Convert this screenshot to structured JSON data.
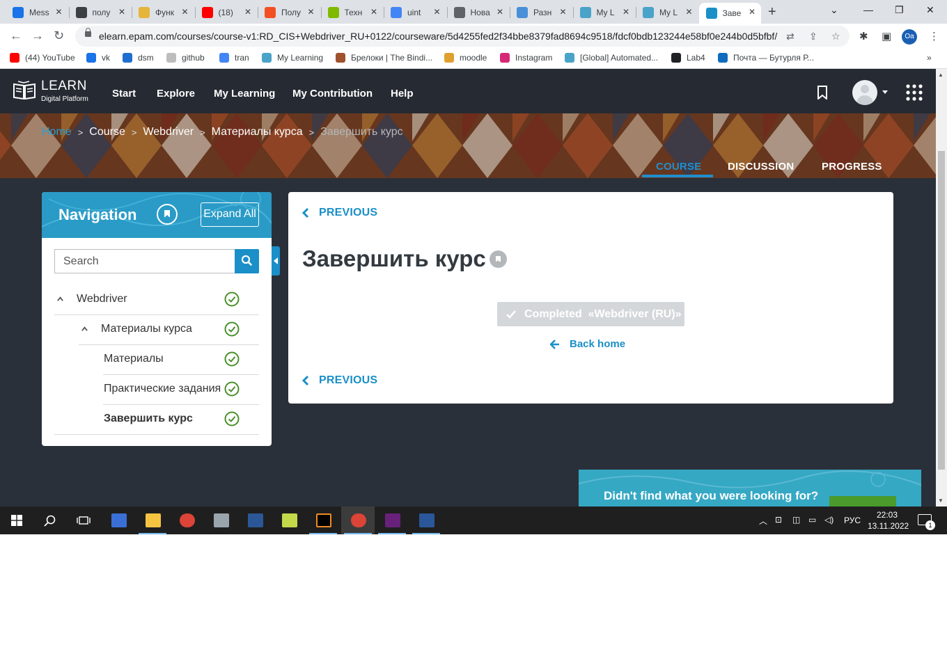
{
  "browser": {
    "tabs": [
      {
        "title": "Mess",
        "color": "#1a73e8"
      },
      {
        "title": "полу",
        "color": "#3c4043"
      },
      {
        "title": "Функ",
        "color": "#e5b53c"
      },
      {
        "title": "(18) ",
        "color": "#ff0000"
      },
      {
        "title": "Полу",
        "color": "#f25022"
      },
      {
        "title": "Техн",
        "color": "#7fba00"
      },
      {
        "title": "uint ",
        "color": "#4285f4"
      },
      {
        "title": "Нова",
        "color": "#5f6368"
      },
      {
        "title": "Разн",
        "color": "#4a90d9"
      },
      {
        "title": "My L",
        "color": "#4aa3c8"
      },
      {
        "title": "My L",
        "color": "#4aa3c8"
      },
      {
        "title": "Заве",
        "color": "#1a8fc8"
      }
    ],
    "url": "elearn.epam.com/courses/course-v1:RD_CIS+Webdriver_RU+0122/courseware/5d4255fed2f34bbe8379fad8694c9518/fdcf0bdb123244e58bf0e244b0d5bfbf/",
    "profile_initials": "Oa",
    "bookmarks": [
      {
        "label": "(44) YouTube",
        "color": "#ff0000"
      },
      {
        "label": "vk",
        "color": "#1a73e8"
      },
      {
        "label": "dsm",
        "color": "#1f6fd1"
      },
      {
        "label": "github",
        "color": "#bdbdbd"
      },
      {
        "label": "tran",
        "color": "#4285f4"
      },
      {
        "label": "My Learning",
        "color": "#4aa3c8"
      },
      {
        "label": "Брелоки | The Bindi...",
        "color": "#a0522d"
      },
      {
        "label": "moodle",
        "color": "#e0a030"
      },
      {
        "label": "Instagram",
        "color": "#d62976"
      },
      {
        "label": "[Global] Automated...",
        "color": "#4aa3c8"
      },
      {
        "label": "Lab4",
        "color": "#202124"
      },
      {
        "label": "Почта — Бутурля Р...",
        "color": "#0f6cbd"
      }
    ],
    "bookmarks_more": "»"
  },
  "header": {
    "logo_title": "LEARN",
    "logo_subtitle": "Digital Platform",
    "nav": [
      "Start",
      "Explore",
      "My Learning",
      "My Contribution",
      "Help"
    ]
  },
  "breadcrumb": {
    "items": [
      "Home",
      "Course",
      "Webdriver",
      "Материалы курса",
      "Завершить курс"
    ],
    "separator": ">"
  },
  "course_tabs": {
    "items": [
      "COURSE",
      "DISCUSSION",
      "PROGRESS"
    ],
    "active": "COURSE"
  },
  "navigation": {
    "title": "Navigation",
    "expand_label": "Expand All",
    "search_placeholder": "Search",
    "items": [
      {
        "label": "Webdriver",
        "level": 0,
        "expanded": true,
        "bold": false
      },
      {
        "label": "Материалы курса",
        "level": 1,
        "expanded": true,
        "bold": false
      },
      {
        "label": "Материалы",
        "level": 2,
        "bold": false
      },
      {
        "label": "Практические задания",
        "level": 2,
        "bold": false
      },
      {
        "label": "Завершить курс",
        "level": 2,
        "bold": true
      }
    ]
  },
  "content": {
    "previous_label": "PREVIOUS",
    "title": "Завершить курс",
    "completed_label": "Completed  «Webdriver (RU)»",
    "back_home_label": "Back home"
  },
  "help_banner": {
    "text": "Didn't find what you were looking for?"
  },
  "taskbar": {
    "language": "РУС",
    "time": "22:03",
    "date": "13.11.2022",
    "notifications": "1"
  },
  "colors": {
    "accent": "#1a8fc8",
    "header_bg": "#262b33",
    "page_bg": "#2a3039",
    "check_green": "#4a8f2a"
  }
}
